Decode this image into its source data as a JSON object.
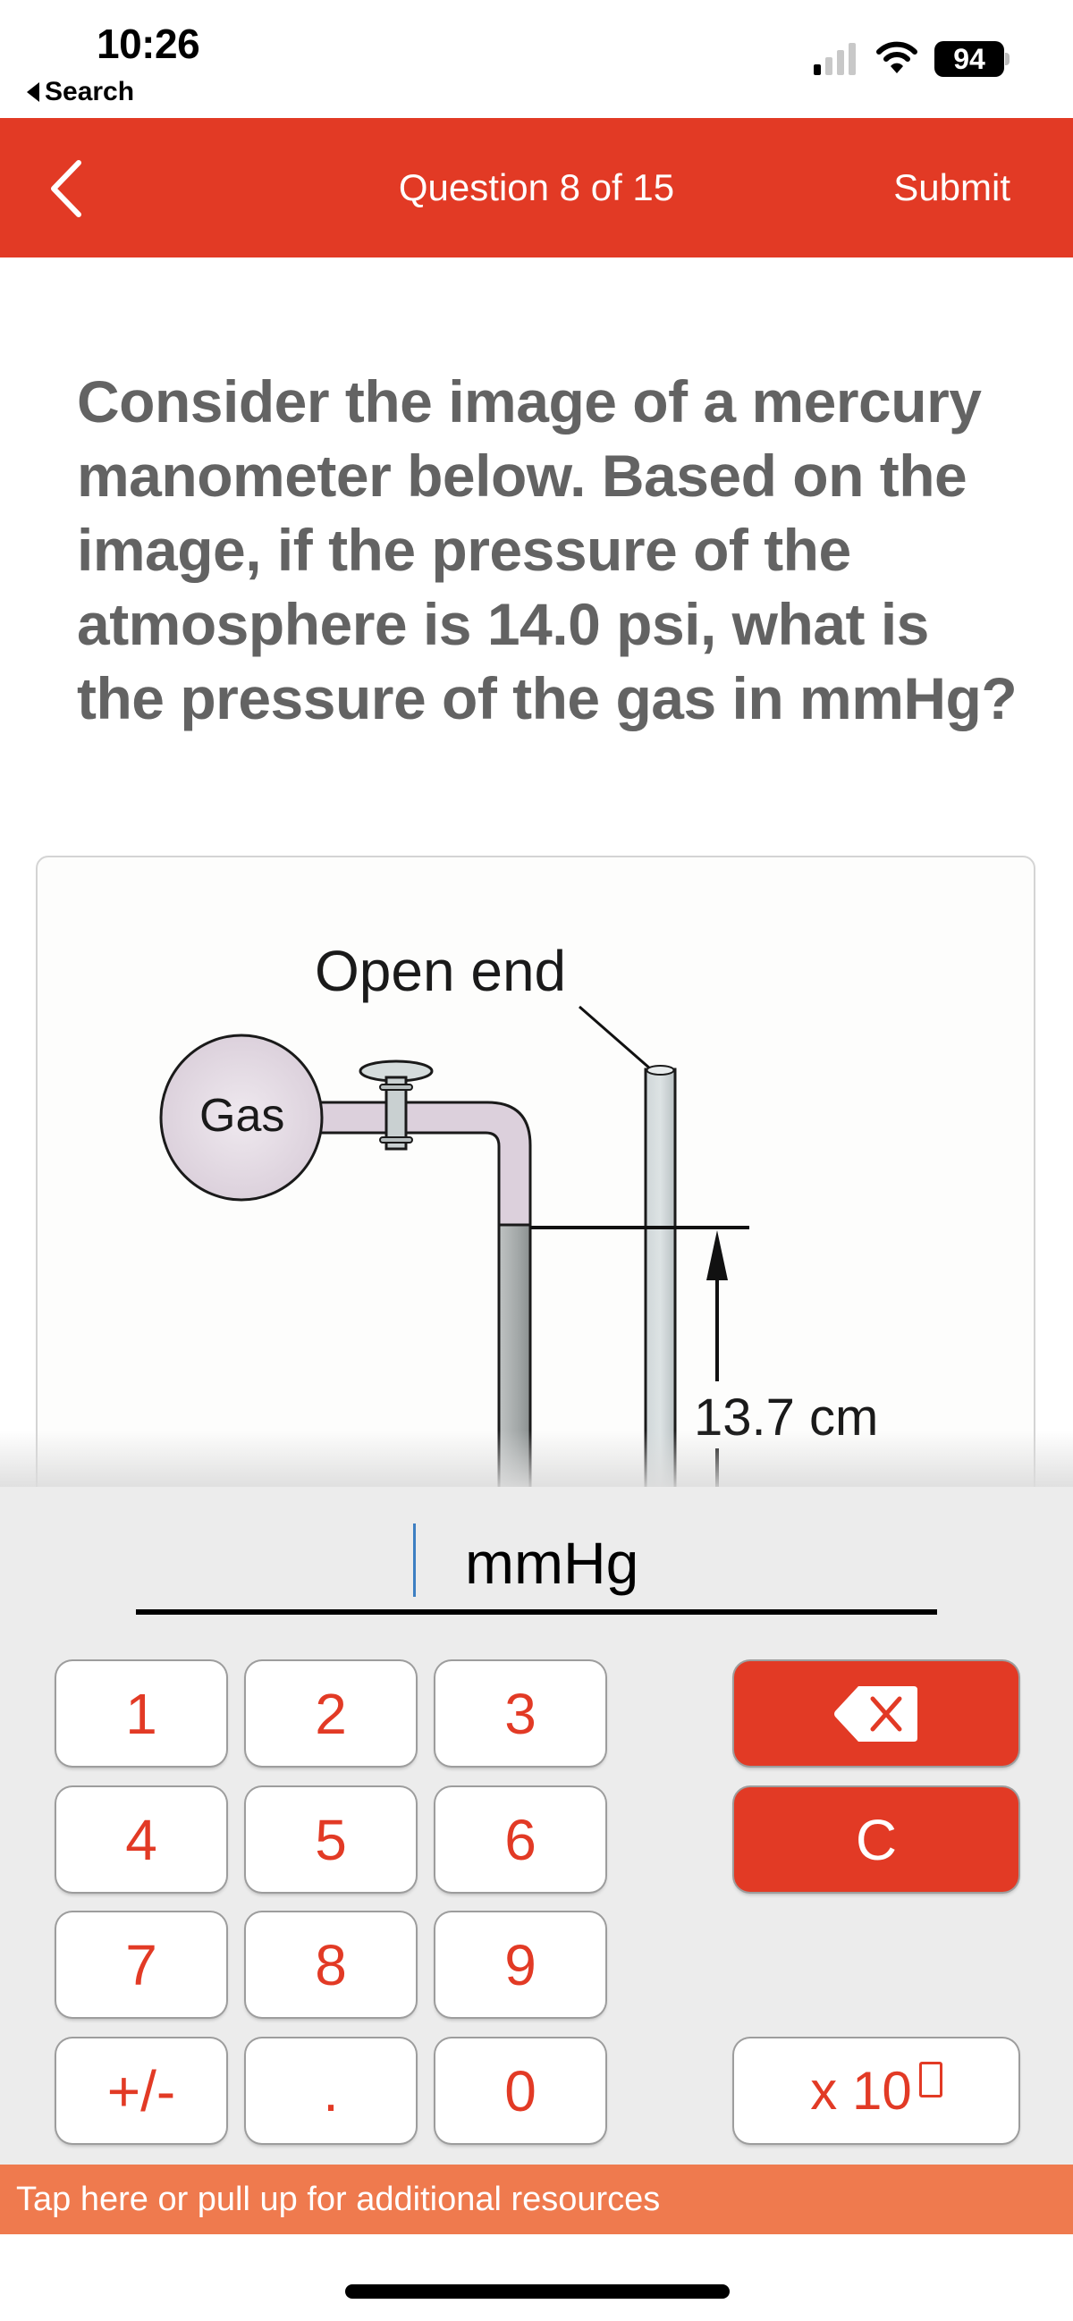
{
  "status_bar": {
    "time": "10:26",
    "back_app_label": "Search",
    "signal_bars_active": 1,
    "signal_bars_total": 4,
    "battery_level": "94",
    "icons": [
      "signal-icon",
      "wifi-icon",
      "battery-icon"
    ]
  },
  "header": {
    "back_icon": "chevron-left-icon",
    "title": "Question 8 of 15",
    "submit_label": "Submit",
    "color": "#E23A25"
  },
  "question": {
    "text": "Consider the image of a mercury manometer below. Based on the image, if the pressure of the atmosphere is 14.0 psi, what is the pressure of the gas in mmHg?"
  },
  "figure": {
    "gas_label": "Gas",
    "open_end_label": "Open end",
    "height_difference_label": "13.7 cm"
  },
  "answer": {
    "value": "",
    "unit": "mmHg"
  },
  "keypad": {
    "keys": [
      {
        "label": "1",
        "name": "key-1"
      },
      {
        "label": "2",
        "name": "key-2"
      },
      {
        "label": "3",
        "name": "key-3"
      },
      {
        "label": "4",
        "name": "key-4"
      },
      {
        "label": "5",
        "name": "key-5"
      },
      {
        "label": "6",
        "name": "key-6"
      },
      {
        "label": "7",
        "name": "key-7"
      },
      {
        "label": "8",
        "name": "key-8"
      },
      {
        "label": "9",
        "name": "key-9"
      },
      {
        "label": "+/-",
        "name": "key-sign"
      },
      {
        "label": ".",
        "name": "key-decimal"
      },
      {
        "label": "0",
        "name": "key-0"
      }
    ],
    "backspace_icon": "backspace-icon",
    "clear_label": "C",
    "x10_label": "x 10",
    "accent_color": "#E23A25"
  },
  "resources_bar": {
    "label": "Tap here or pull up for additional resources",
    "color": "#EF7A4E"
  }
}
